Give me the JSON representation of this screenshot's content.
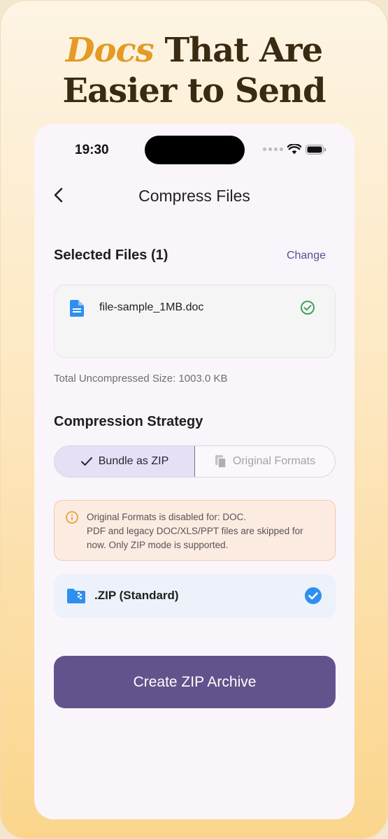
{
  "headline": {
    "accent": "Docs",
    "line1_rest": " That Are",
    "line2": "Easier to Send"
  },
  "status_bar": {
    "time": "19:30"
  },
  "nav": {
    "title": "Compress Files"
  },
  "selected": {
    "title": "Selected Files (1)",
    "change_label": "Change",
    "files": [
      {
        "name": "file-sample_1MB.doc"
      }
    ],
    "total_size": "Total Uncompressed Size: 1003.0 KB"
  },
  "strategy": {
    "title": "Compression Strategy",
    "options": [
      {
        "label": "Bundle as ZIP",
        "selected": true
      },
      {
        "label": "Original Formats",
        "selected": false
      }
    ]
  },
  "notice": {
    "line1": "Original Formats is disabled for: DOC.",
    "line2": "PDF and legacy DOC/XLS/PPT files are skipped for",
    "line3": "now. Only ZIP mode is supported."
  },
  "format": {
    "label": ".ZIP (Standard)"
  },
  "cta": {
    "label": "Create ZIP Archive"
  },
  "colors": {
    "accent": "#e49a24",
    "primary": "#62538c",
    "check_green": "#3aa35c",
    "check_blue": "#2f8ff0"
  }
}
